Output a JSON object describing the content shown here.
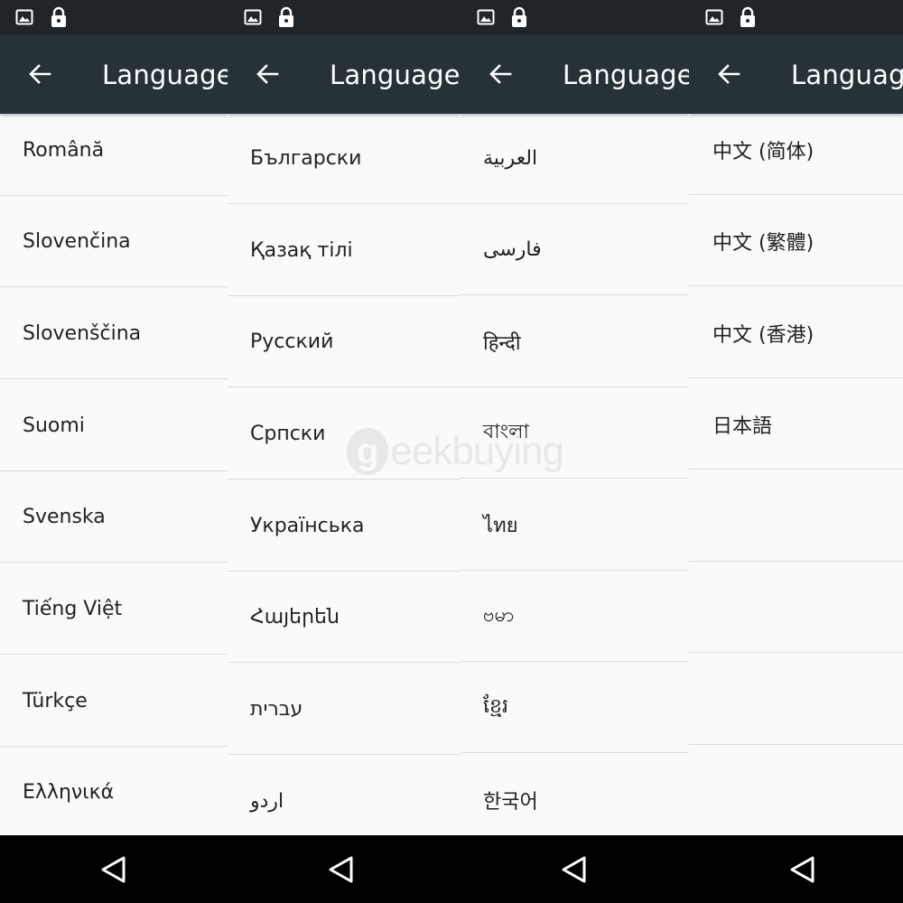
{
  "panels": [
    {
      "title": "Language",
      "items": [
        "Română",
        "Slovenčina",
        "Slovenščina",
        "Suomi",
        "Svenska",
        "Tiếng Việt",
        "Türkçe",
        "Ελληνικά"
      ]
    },
    {
      "title": "Language",
      "items": [
        "Български",
        "Қазақ тілі",
        "Русский",
        "Српски",
        "Українська",
        "Հայերեն",
        "עברית",
        "اردو"
      ]
    },
    {
      "title": "Language",
      "items": [
        "العربية",
        "فارسی",
        "हिन्दी",
        "বাংলা",
        "ไทย",
        "ဗမာ",
        "ខ្មែរ",
        "한국어"
      ]
    },
    {
      "title": "Language",
      "items": [
        "中文 (简体)",
        "中文 (繁體)",
        "中文 (香港)",
        "日本語",
        "",
        "",
        "",
        ""
      ]
    }
  ],
  "watermark": {
    "mark": "g",
    "text": "eekbuying"
  },
  "colors": {
    "status_bar": "#1f2529",
    "toolbar": "#263238",
    "list_background": "#fafafa",
    "divider": "#dcdcdc",
    "nav_bar": "#000000"
  },
  "icons": {
    "status_left": "image-icon",
    "status_right": "lock-icon",
    "toolbar_back": "arrow-back-icon",
    "nav_back": "triangle-back-icon"
  }
}
